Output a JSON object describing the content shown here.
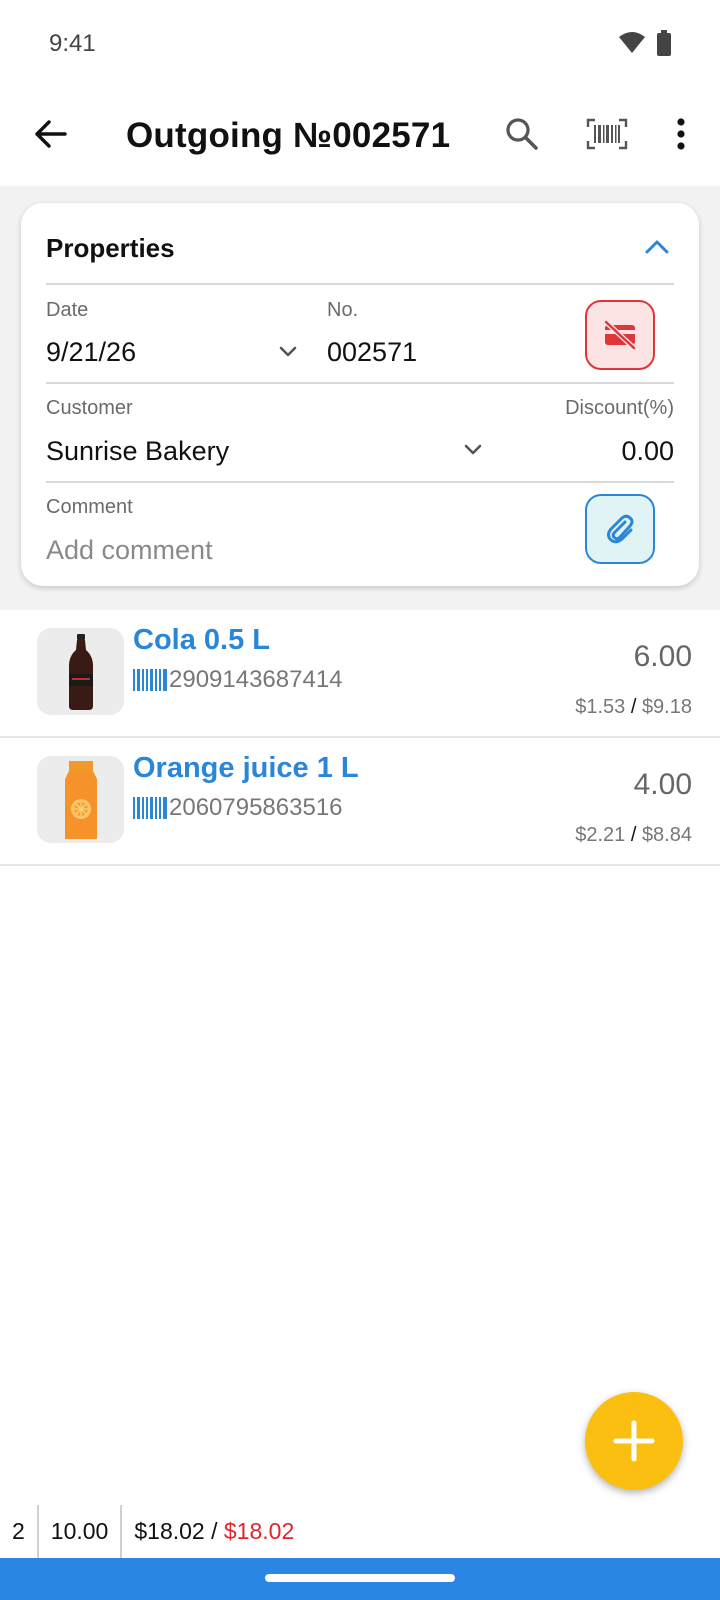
{
  "status": {
    "time": "9:41"
  },
  "appbar": {
    "title": "Outgoing №002571"
  },
  "properties": {
    "title": "Properties",
    "date_label": "Date",
    "date_value": "9/21/26",
    "no_label": "No.",
    "no_value": "002571",
    "customer_label": "Customer",
    "customer_value": "Sunrise Bakery",
    "discount_label": "Discount(%)",
    "discount_value": "0.00",
    "comment_label": "Comment",
    "comment_placeholder": "Add comment"
  },
  "items": [
    {
      "name": "Cola 0.5 L",
      "barcode": "2909143687414",
      "qty": "6.00",
      "unit_price": "$1.53",
      "total": "$9.18"
    },
    {
      "name": "Orange juice 1 L",
      "barcode": "2060795863516",
      "qty": "4.00",
      "unit_price": "$2.21",
      "total": "$8.84"
    }
  ],
  "summary": {
    "count": "2",
    "quantity": "10.00",
    "total": "$18.02",
    "separator": "/",
    "total_with_discount": "$18.02"
  },
  "colors": {
    "accent": "#2a86d8",
    "fab": "#fbbf11",
    "danger": "#e0363a",
    "nav": "#2a86e2"
  },
  "icons": [
    "back-arrow-icon",
    "search-icon",
    "barcode-scanner-icon",
    "more-vert-icon",
    "chevron-up-icon",
    "chevron-down-icon",
    "card-off-icon",
    "paperclip-icon",
    "barcode-icon",
    "plus-icon",
    "wifi-icon",
    "battery-icon"
  ]
}
